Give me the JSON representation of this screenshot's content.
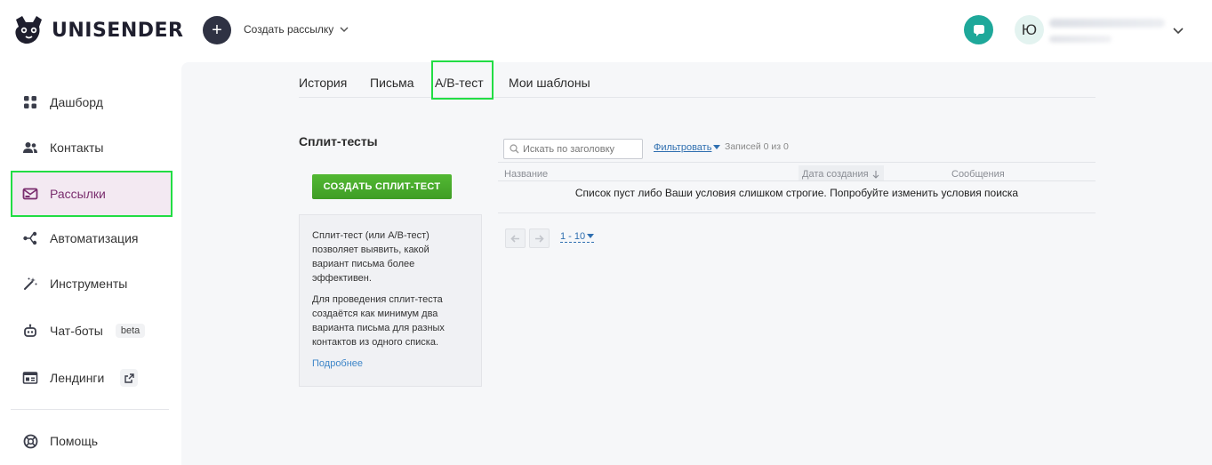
{
  "header": {
    "brand": "UNISENDER",
    "create_label": "Создать рассылку",
    "avatar_letter": "Ю"
  },
  "sidebar": {
    "items": [
      {
        "label": "Дашборд",
        "icon": "dashboard-icon"
      },
      {
        "label": "Контакты",
        "icon": "contacts-icon"
      },
      {
        "label": "Рассылки",
        "icon": "mail-icon",
        "active": true
      },
      {
        "label": "Автоматизация",
        "icon": "automation-icon"
      },
      {
        "label": "Инструменты",
        "icon": "magic-wand-icon"
      },
      {
        "label": "Чат-боты",
        "icon": "bot-icon",
        "badge": "beta"
      },
      {
        "label": "Лендинги",
        "icon": "landing-icon"
      },
      {
        "label": "Помощь",
        "icon": "help-icon"
      }
    ]
  },
  "tabs": [
    "История",
    "Письма",
    "A/B-тест",
    "Мои шаблоны"
  ],
  "active_tab": "A/B-тест",
  "split": {
    "title": "Сплит-тесты",
    "create_button": "СОЗДАТЬ СПЛИТ-ТЕСТ",
    "info_p1": "Сплит-тест (или A/B-тест) позволяет выявить, какой вариант письма более эффективен.",
    "info_p2": "Для проведения сплит-теста создаётся как минимум два варианта письма для разных контактов из одного списка.",
    "info_link": "Подробнее"
  },
  "list": {
    "search_placeholder": "Искать по заголовку",
    "filter_label": "Фильтровать",
    "records": "Записей 0 из 0",
    "columns": [
      "Название",
      "Дата создания",
      "Сообщения"
    ],
    "empty_message": "Список пуст либо Ваши условия слишком строгие. Попробуйте изменить условия поиска",
    "page_range": "1 - 10"
  },
  "colors": {
    "accent_green": "#4aae2d",
    "active_nav_bg": "#f3e9f2",
    "active_nav_text": "#7a2d6e",
    "chat_teal": "#1ea89a",
    "highlight": "#22dd44"
  }
}
